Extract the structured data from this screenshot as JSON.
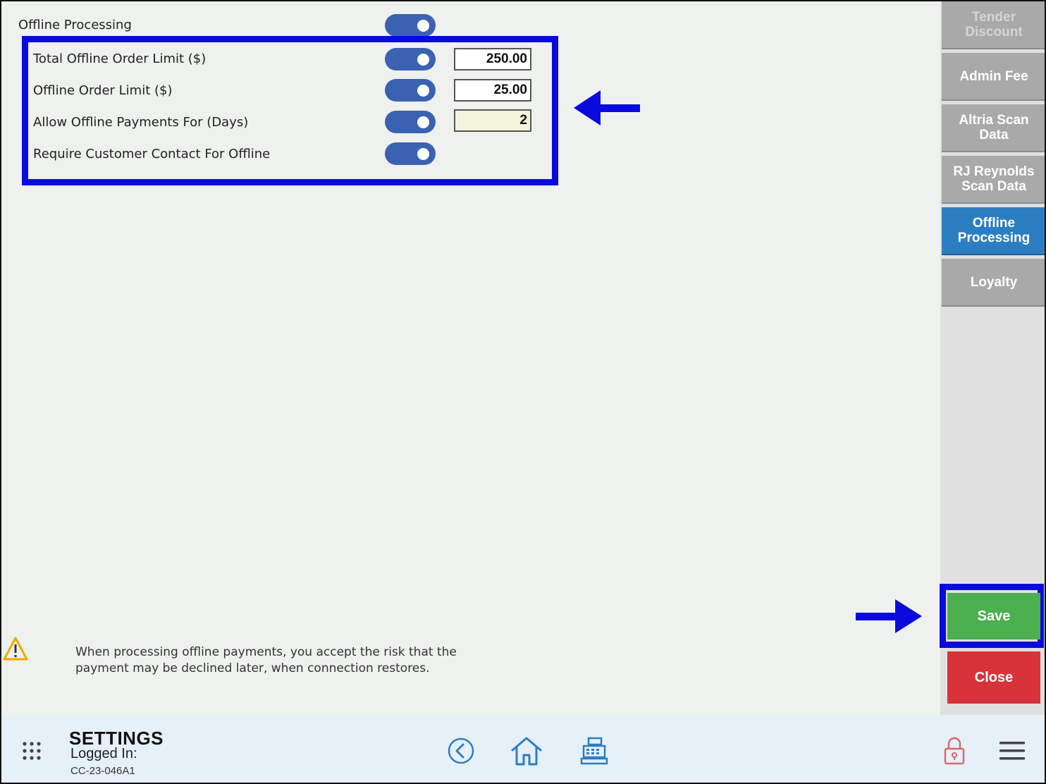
{
  "settings": {
    "offline_processing": {
      "label": "Offline Processing",
      "enabled": true
    },
    "rows": [
      {
        "label": "Total Offline Order Limit ($)",
        "enabled": true,
        "value": "250.00"
      },
      {
        "label": "Offline Order Limit ($)",
        "enabled": true,
        "value": "25.00"
      },
      {
        "label": "Allow Offline Payments For (Days)",
        "enabled": true,
        "value": "2"
      },
      {
        "label": "Require Customer Contact For Offline",
        "enabled": true
      }
    ]
  },
  "warning": {
    "icon": "warning-triangle-icon",
    "text_line1": "When processing offline payments, you accept the risk that the",
    "text_line2": "payment may be declined later, when connection restores."
  },
  "sidebar": {
    "items": [
      {
        "label_line1": "Tender",
        "label_line2": "Discount"
      },
      {
        "label_line1": "Admin Fee",
        "label_line2": ""
      },
      {
        "label_line1": "Altria Scan",
        "label_line2": "Data"
      },
      {
        "label_line1": "RJ Reynolds",
        "label_line2": "Scan Data"
      },
      {
        "label_line1": "Offline",
        "label_line2": "Processing"
      },
      {
        "label_line1": "Loyalty",
        "label_line2": ""
      }
    ],
    "active_index": 4
  },
  "actions": {
    "save_label": "Save",
    "close_label": "Close"
  },
  "footer": {
    "title": "SETTINGS",
    "logged_in": "Logged In:",
    "store_id": "CC-23-046A1",
    "icons": [
      "apps-grid-icon",
      "back-icon",
      "home-icon",
      "register-icon",
      "lock-icon",
      "menu-icon"
    ]
  },
  "colors": {
    "toggle_on": "#3a62b0",
    "highlight": "#0a0adf",
    "sidebar_active": "#2c7ec2",
    "save": "#4caf50",
    "close": "#d8323a"
  }
}
